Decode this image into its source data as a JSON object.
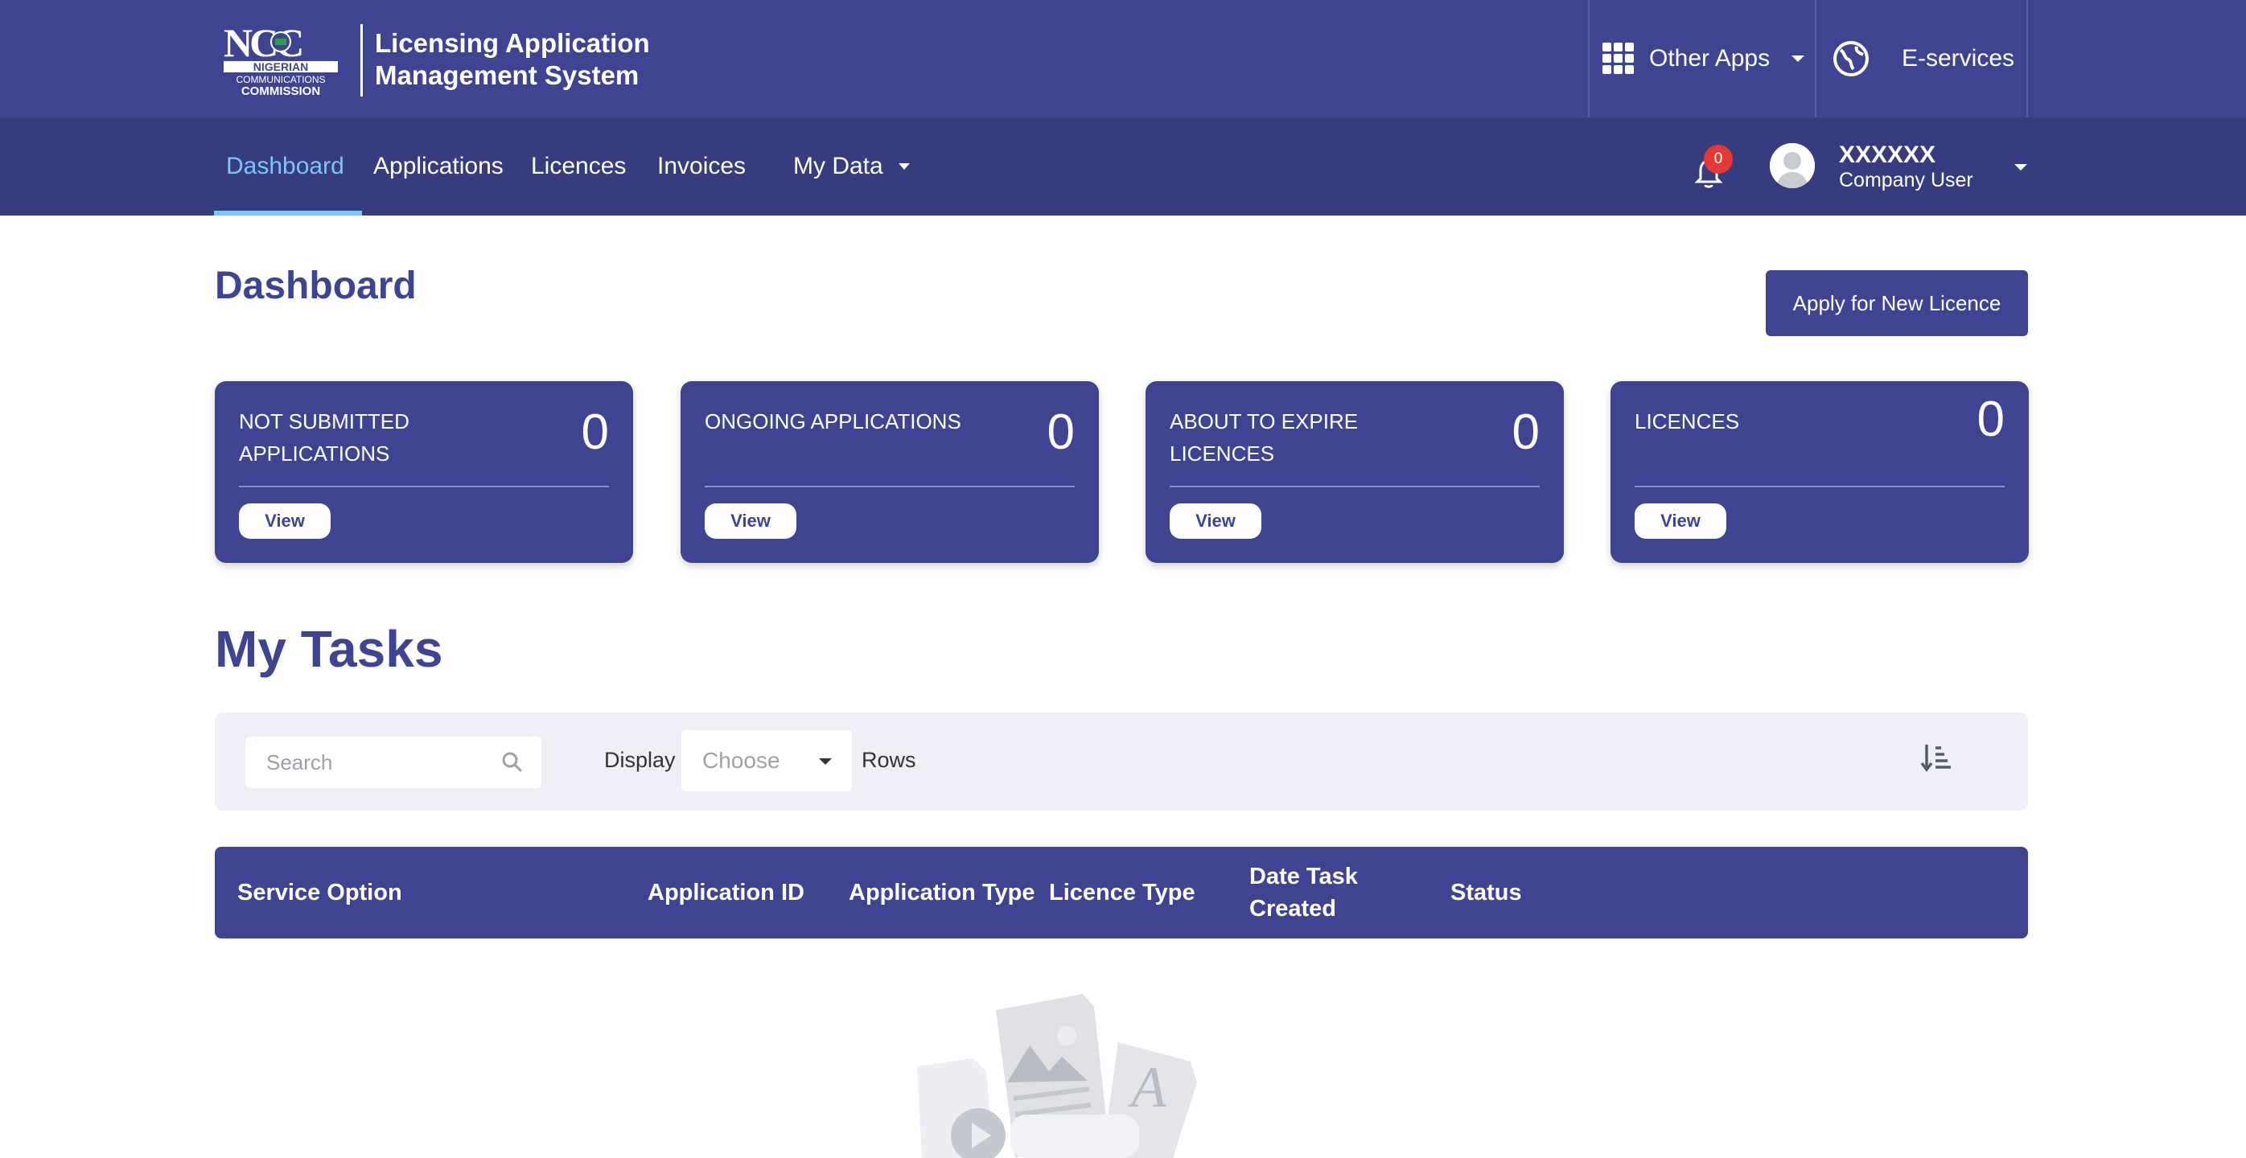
{
  "header": {
    "logo_text": "NCC NIGERIAN COMMUNICATIONS COMMISSION",
    "app_title_line1": "Licensing Application",
    "app_title_line2": "Management System",
    "other_apps_label": "Other Apps",
    "eservices_label": "E-services"
  },
  "nav": {
    "items": [
      {
        "label": "Dashboard",
        "active": true
      },
      {
        "label": "Applications"
      },
      {
        "label": "Licences"
      },
      {
        "label": "Invoices"
      },
      {
        "label": "My Data"
      }
    ],
    "notification_count": "0",
    "user_name": "XXXXXX",
    "user_role": "Company User"
  },
  "page": {
    "title": "Dashboard",
    "apply_button": "Apply for New Licence"
  },
  "cards": [
    {
      "label": "NOT SUBMITTED APPLICATIONS",
      "count": "0",
      "button": "View"
    },
    {
      "label": "ONGOING APPLICATIONS",
      "count": "0",
      "button": "View"
    },
    {
      "label": "ABOUT TO EXPIRE LICENCES",
      "count": "0",
      "button": "View"
    },
    {
      "label": "LICENCES",
      "count": "0",
      "button": "View"
    }
  ],
  "tasks": {
    "title": "My Tasks",
    "search_placeholder": "Search",
    "display_label": "Display",
    "rows_select_value": "Choose",
    "rows_label": "Rows",
    "columns": [
      "Service Option",
      "Application ID",
      "Application Type",
      "Licence Type",
      "Date Task Created",
      "Status"
    ]
  },
  "colors": {
    "brand": "#3e4491",
    "nav": "#363c7e",
    "active": "#7cc3ff",
    "badge": "#e53935"
  }
}
